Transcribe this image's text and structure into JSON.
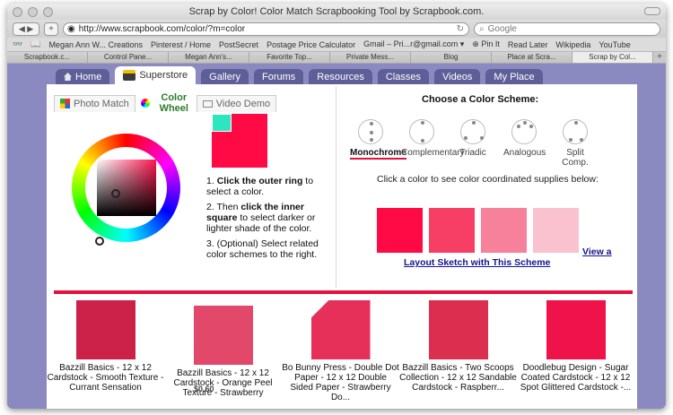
{
  "browser": {
    "title": "Scrap by Color! Color Match Scrapbooking Tool by Scrapbook.com.",
    "url": "http://www.scrapbook.com/color/?m=color",
    "search_placeholder": "Google",
    "bookmarks": [
      "Megan Ann W... Creations",
      "Pinterest / Home",
      "PostSecret",
      "Postage Price Calculator",
      "Gmail – Pri...r@gmail.com ▾",
      "⊕ Pin It",
      "Read Later",
      "Wikipedia",
      "YouTube"
    ],
    "tabs": [
      "Scrapbook.c...",
      "Control Pane...",
      "Megan Ann's...",
      "Favorite Top...",
      "Private Mess...",
      "Blog",
      "Place at Scra...",
      "Scrap by Col..."
    ],
    "active_tab_index": 7
  },
  "sitenav": {
    "tabs": [
      "Home",
      "Superstore",
      "Gallery",
      "Forums",
      "Resources",
      "Classes",
      "Videos",
      "My Place"
    ],
    "active_index": 1
  },
  "subtabs": {
    "photo_match": "Photo Match",
    "color_wheel": "Color Wheel",
    "video_demo": "Video Demo"
  },
  "instructions": {
    "step1_bold": "Click the outer ring",
    "step1_rest": "to select a color.",
    "step2_pre": "2. Then ",
    "step2_bold": "click the inner square",
    "step2_rest": "to select darker or lighter shade of the color.",
    "step3": "3. (Optional) Select related color schemes to the right."
  },
  "schemes": {
    "title": "Choose a Color Scheme:",
    "items": [
      "Monochrome",
      "Complementary",
      "Triadic",
      "Analogous",
      "Split Comp."
    ],
    "active_index": 0
  },
  "supplies": {
    "hint": "Click a color to see color coordinated supplies below:",
    "swatches": [
      "#ff0a45",
      "#f73f66",
      "#f7809a",
      "#fac2cf"
    ],
    "view_link": "View a",
    "layout_link": "Layout Sketch with This Scheme"
  },
  "colors": {
    "selected": "#ff0a45",
    "accent_bar": "#e8103f",
    "link": "#14148e",
    "nav": "#5e5e98"
  },
  "products": [
    {
      "name": "Bazzill Basics - 12 x 12 Cardstock - Smooth Texture - Currant Sensation",
      "color": "#cc2249"
    },
    {
      "name": "Bazzill Basics - 12 x 12 Cardstock - Orange Peel Texture - Strawberry",
      "color": "#e2486a"
    },
    {
      "name": "Bo Bunny Press - Double Dot Paper - 12 x 12 Double Sided Paper - Strawberry Do...",
      "color": "#e6305a"
    },
    {
      "name": "Bazzill Basics - Two Scoops Collection - 12 x 12 Sandable Cardstock - Raspberr...",
      "color": "#dc2f4f"
    },
    {
      "name": "Doodlebug Design - Sugar Coated Cardstock - 12 x 12 Spot Glittered Cardstock -...",
      "color": "#f0124a"
    }
  ],
  "price_stub": "$0.60"
}
